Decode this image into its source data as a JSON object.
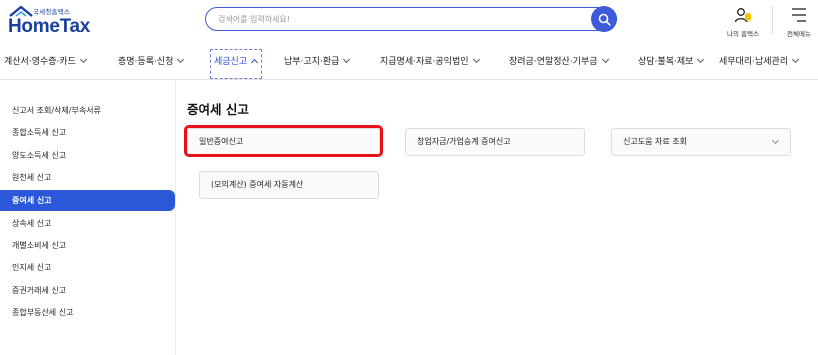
{
  "header": {
    "logo_sub": "국세청홈택스",
    "logo_main": "HomeTax",
    "search_placeholder": "검색어를 입력하세요!",
    "my_hometax_label": "나의 홈택스",
    "all_menu_label": "전체메뉴"
  },
  "nav": {
    "items": [
      {
        "label": "계산서·영수증·카드"
      },
      {
        "label": "증명·등록·신청"
      },
      {
        "label": "세금신고"
      },
      {
        "label": "납부·고지·환급"
      },
      {
        "label": "지급명세·자료·공익법인"
      },
      {
        "label": "장려금·연말정산·기부금"
      },
      {
        "label": "상담·불복·제보"
      },
      {
        "label": "세무대리·납세관리"
      }
    ],
    "active_index": 2
  },
  "sidebar": {
    "items": [
      {
        "label": "신고서 조회/삭제/부속서류"
      },
      {
        "label": "종합소득세 신고"
      },
      {
        "label": "양도소득세 신고"
      },
      {
        "label": "원천세 신고"
      },
      {
        "label": "증여세 신고"
      },
      {
        "label": "상속세 신고"
      },
      {
        "label": "개별소비세 신고"
      },
      {
        "label": "인지세 신고"
      },
      {
        "label": "증권거래세 신고"
      },
      {
        "label": "종합부동산세 신고"
      }
    ],
    "active_index": 4
  },
  "main": {
    "title": "증여세 신고",
    "cards": [
      {
        "label": "일반증여신고"
      },
      {
        "label": "창업자금/가업승계 증여신고"
      },
      {
        "label": "신고도움 자료 조회"
      },
      {
        "label": "(모의계산) 증여세 자동계산"
      }
    ]
  },
  "colors": {
    "brand": "#1a3f9c",
    "accent": "#2b58d8",
    "highlight": "#e4131b"
  },
  "icons": [
    "home-roof-icon",
    "search-icon",
    "user-bell-icon",
    "hamburger-menu-icon",
    "chevron-down-icon",
    "chevron-up-icon"
  ]
}
